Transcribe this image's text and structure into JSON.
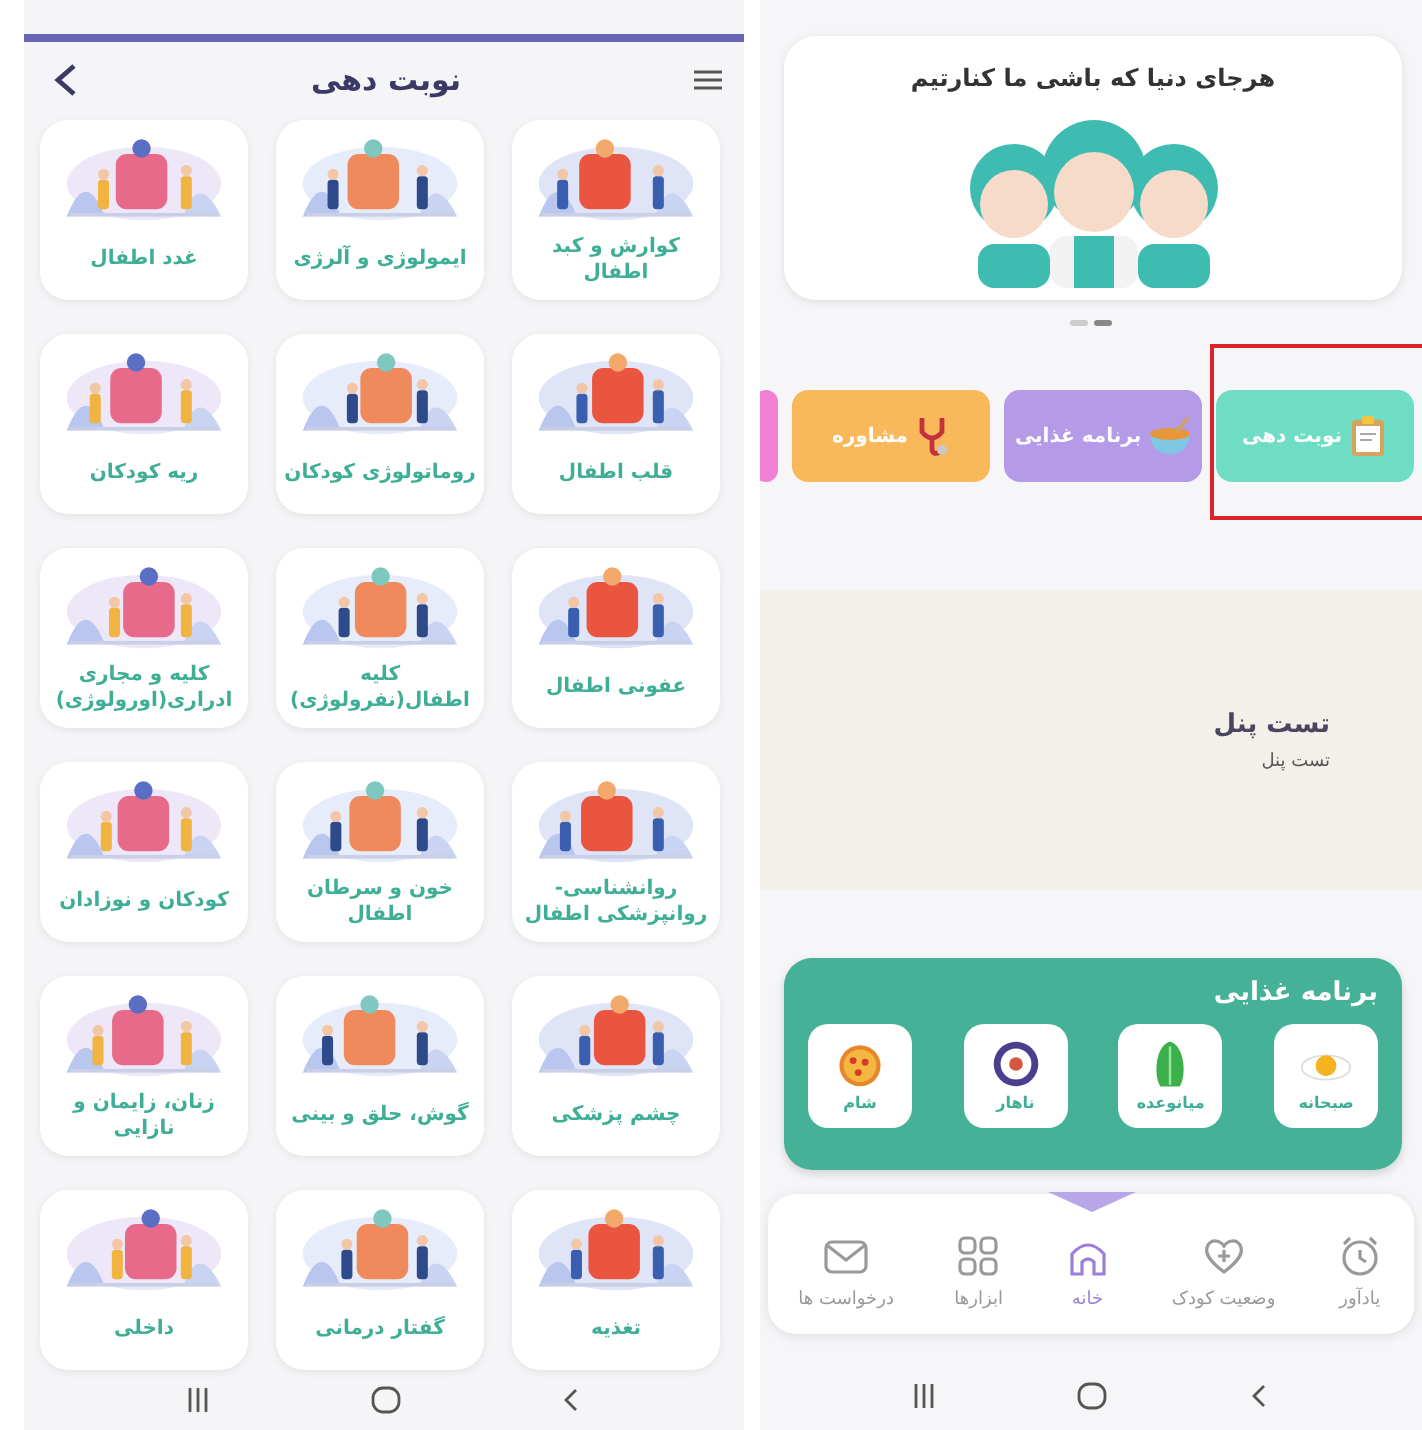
{
  "appointments_screen": {
    "title": "نوبت دهی",
    "specialties": [
      {
        "label": "کوارش و کبد اطفال"
      },
      {
        "label": "ایمولوژی و آلرژی"
      },
      {
        "label": "غدد اطفال"
      },
      {
        "label": "قلب اطفال"
      },
      {
        "label": "روماتولوژی کودکان"
      },
      {
        "label": "ریه کودکان"
      },
      {
        "label": "عفونی اطفال"
      },
      {
        "label": "کلیه اطفال(نفرولوژی)"
      },
      {
        "label": "کلیه و مجاری ادراری(اورولوژی)"
      },
      {
        "label": "روانشناسی-روانپزشکی اطفال"
      },
      {
        "label": "خون و سرطان اطفال"
      },
      {
        "label": "کودکان و نوزادان"
      },
      {
        "label": "چشم پزشکی"
      },
      {
        "label": "گوش، حلق و بینی"
      },
      {
        "label": "زنان، زایمان و نازایی"
      },
      {
        "label": "تغذیه"
      },
      {
        "label": "گفتار درمانی"
      },
      {
        "label": "داخلی"
      }
    ]
  },
  "home_screen": {
    "banner": {
      "text": "هرجای دنیا که باشی ما کنارتیم",
      "kind": "picture"
    },
    "quick_actions": [
      {
        "label": "نوبت دهی",
        "color": "#6fdcc4",
        "highlighted": true
      },
      {
        "label": "برنامه غذایی",
        "color": "#b59ae8",
        "highlighted": false
      },
      {
        "label": "مشاوره",
        "color": "#f9b95a",
        "highlighted": false
      },
      {
        "color": "#f27fd6",
        "highlighted": false
      }
    ],
    "test_panel": {
      "title": "تست پنل",
      "subtitle": "تست پنل"
    },
    "diet_plan": {
      "title": "برنامه غذایی",
      "meals": [
        {
          "label": "صبحانه",
          "kind": "egg"
        },
        {
          "label": "میانوعده",
          "kind": "lettuce"
        },
        {
          "label": "ناهار",
          "kind": "plate"
        },
        {
          "label": "شام",
          "kind": "pizza"
        }
      ]
    },
    "bottom_nav": [
      {
        "label": "یادآور",
        "kind": "alarm",
        "selected": false
      },
      {
        "label": "وضعیت کودک",
        "kind": "heart",
        "selected": false
      },
      {
        "label": "خانه",
        "kind": "home",
        "selected": true
      },
      {
        "label": "ابزارها",
        "kind": "grid",
        "selected": false
      },
      {
        "label": "درخواست ها",
        "kind": "mail",
        "selected": false
      }
    ]
  }
}
